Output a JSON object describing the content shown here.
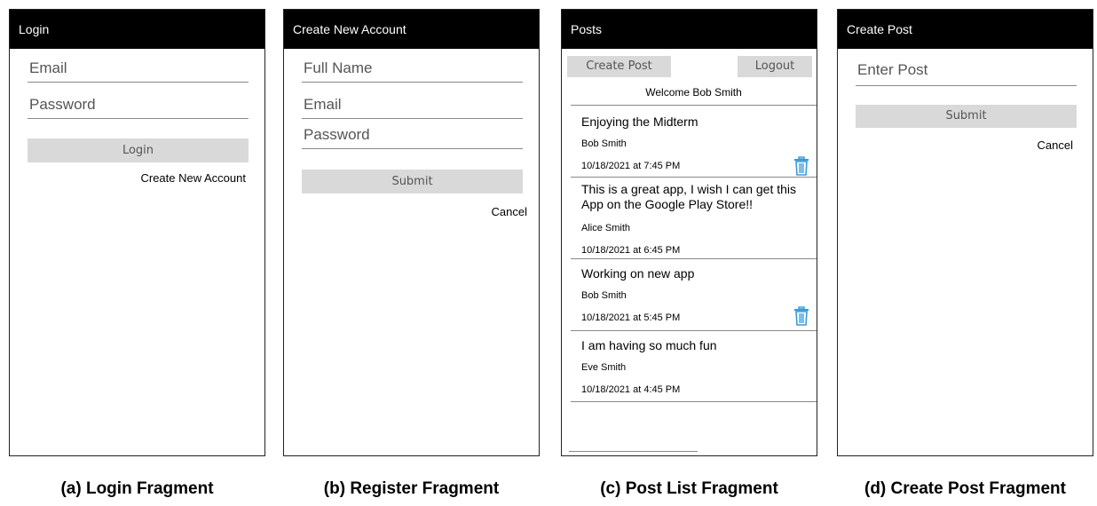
{
  "login": {
    "header": "Login",
    "email_placeholder": "Email",
    "password_placeholder": "Password",
    "login_button": "Login",
    "create_account_link": "Create New Account",
    "caption": "(a) Login Fragment"
  },
  "register": {
    "header": "Create New Account",
    "fullname_placeholder": "Full Name",
    "email_placeholder": "Email",
    "password_placeholder": "Password",
    "submit_button": "Submit",
    "cancel_link": "Cancel",
    "caption": "(b) Register Fragment"
  },
  "posts": {
    "header": "Posts",
    "create_post_button": "Create Post",
    "logout_button": "Logout",
    "welcome": "Welcome Bob Smith",
    "items": [
      {
        "title": "Enjoying the Midterm",
        "author": "Bob Smith",
        "date": "10/18/2021 at 7:45 PM",
        "deletable": true
      },
      {
        "title": "This is a great app, I wish I can get this App on the Google Play Store!!",
        "author": "Alice Smith",
        "date": "10/18/2021 at 6:45 PM",
        "deletable": false
      },
      {
        "title": "Working on new app",
        "author": "Bob Smith",
        "date": "10/18/2021 at 5:45 PM",
        "deletable": true
      },
      {
        "title": "I am having so much fun",
        "author": "Eve Smith",
        "date": "10/18/2021 at 4:45 PM",
        "deletable": false
      }
    ],
    "caption": "(c) Post List Fragment"
  },
  "create_post": {
    "header": "Create Post",
    "post_placeholder": "Enter Post",
    "submit_button": "Submit",
    "cancel_link": "Cancel",
    "caption": "(d) Create Post Fragment"
  },
  "colors": {
    "header_bg": "#000000",
    "button_bg": "#d9d9d9",
    "trash_icon": "#3a9ad9"
  },
  "icons": {
    "delete": "trash-icon"
  }
}
